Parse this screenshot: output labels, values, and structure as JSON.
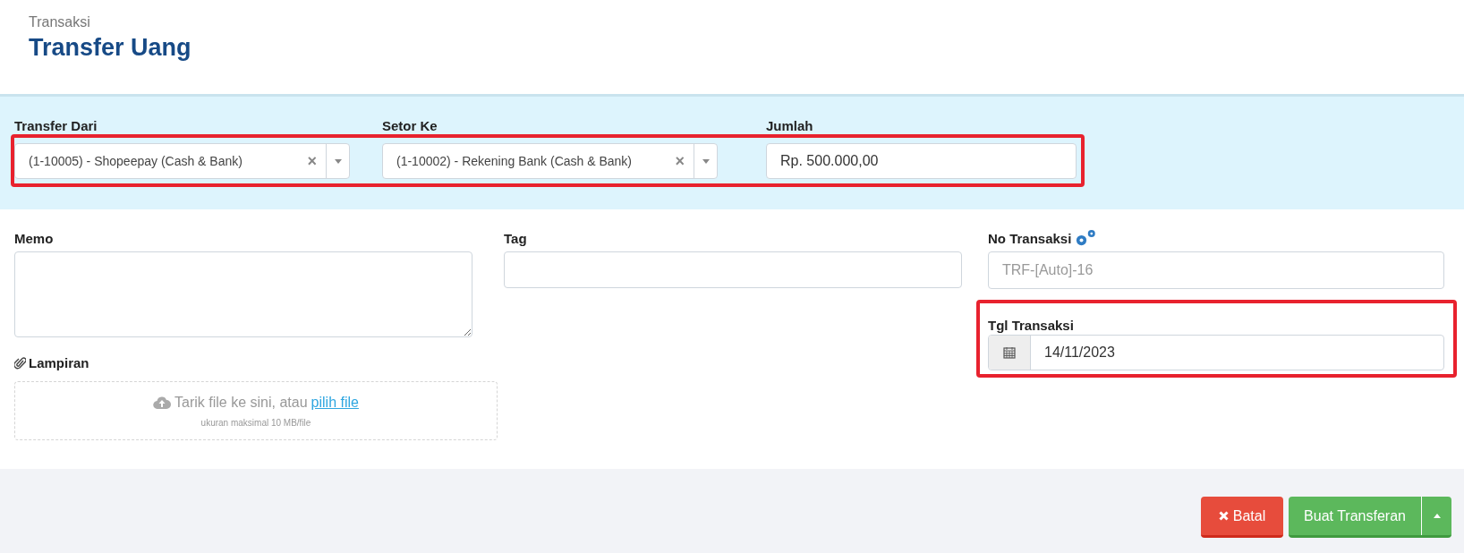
{
  "header": {
    "breadcrumb": "Transaksi",
    "title": "Transfer Uang"
  },
  "transfer": {
    "highlighted": true,
    "fields": [
      {
        "kind": "select",
        "label": "Transfer Dari",
        "value": "(1-10005) - Shopeepay (Cash & Bank)",
        "clear": "×"
      },
      {
        "kind": "select",
        "label": "Setor Ke",
        "value": "(1-10002) - Rekening Bank (Cash & Bank)",
        "clear": "×"
      },
      {
        "kind": "input",
        "label": "Jumlah",
        "value": "Rp. 500.000,00"
      }
    ]
  },
  "memo": {
    "label": "Memo"
  },
  "tag": {
    "label": "Tag"
  },
  "no_transaksi": {
    "label": "No Transaksi",
    "placeholder": "TRF-[Auto]-16"
  },
  "tgl_transaksi": {
    "label": "Tgl Transaksi",
    "value": "14/11/2023",
    "highlighted": true
  },
  "lampiran": {
    "label": "Lampiran",
    "drop_text": "Tarik file ke sini, atau",
    "link": "pilih file",
    "hint": "ukuran maksimal 10 MB/file"
  },
  "buttons": {
    "cancel": "Batal",
    "submit": "Buat Transferan"
  }
}
